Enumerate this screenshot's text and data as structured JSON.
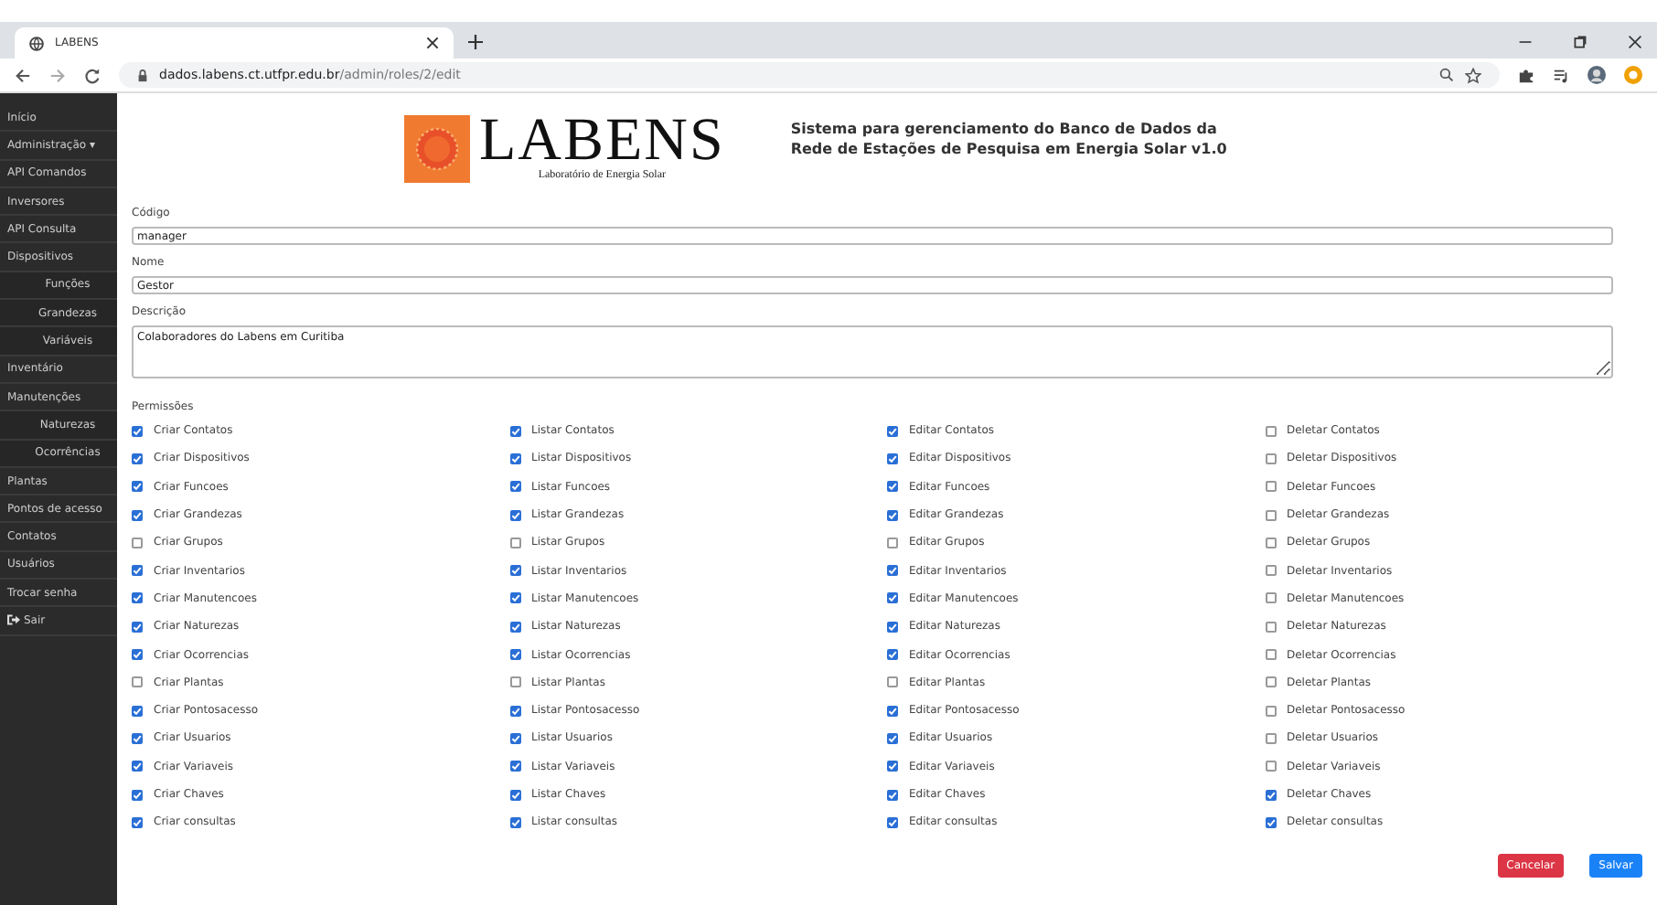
{
  "browser": {
    "tab": {
      "title": "LABENS"
    },
    "url": {
      "host": "dados.labens.ct.utfpr.edu.br",
      "path": "/admin/roles/2/edit"
    }
  },
  "sidebar": {
    "items": [
      {
        "label": "Início",
        "kind": "link"
      },
      {
        "label": "Administração ▾",
        "kind": "link"
      },
      {
        "label": "API Comandos",
        "kind": "link"
      },
      {
        "label": "Inversores",
        "kind": "link"
      },
      {
        "label": "API Consulta",
        "kind": "link"
      },
      {
        "label": "Dispositivos",
        "kind": "link",
        "children": [
          {
            "label": "Funções"
          },
          {
            "label": "Grandezas"
          },
          {
            "label": "Variáveis"
          }
        ]
      },
      {
        "label": "Inventário",
        "kind": "link"
      },
      {
        "label": "Manutenções",
        "kind": "link",
        "children": [
          {
            "label": "Naturezas"
          },
          {
            "label": "Ocorrências"
          }
        ]
      },
      {
        "label": "Plantas",
        "kind": "link"
      },
      {
        "label": "Pontos de acesso",
        "kind": "link"
      },
      {
        "label": "Contatos",
        "kind": "link"
      },
      {
        "label": "Usuários",
        "kind": "link"
      },
      {
        "label": "Trocar senha",
        "kind": "link"
      },
      {
        "label": "Sair",
        "kind": "logout"
      }
    ]
  },
  "header": {
    "logo": {
      "title": "LABENS",
      "subtitle": "Laboratório de Energia Solar"
    },
    "system_title": [
      "Sistema para gerenciamento do Banco de Dados da",
      "Rede de Estações de Pesquisa em Energia Solar v1.0"
    ]
  },
  "form": {
    "fields": [
      {
        "label": "Código",
        "value": "manager",
        "kind": "input"
      },
      {
        "label": "Nome",
        "value": "Gestor",
        "kind": "input"
      },
      {
        "label": "Descrição",
        "value": "Colaboradores do Labens em Curitiba",
        "kind": "textarea"
      }
    ],
    "permissions": {
      "label": "Permissões",
      "items": [
        {
          "label": "Criar Contatos",
          "checked": true
        },
        {
          "label": "Listar Contatos",
          "checked": true
        },
        {
          "label": "Editar Contatos",
          "checked": true
        },
        {
          "label": "Deletar Contatos",
          "checked": false
        },
        {
          "label": "Criar Dispositivos",
          "checked": true
        },
        {
          "label": "Listar Dispositivos",
          "checked": true
        },
        {
          "label": "Editar Dispositivos",
          "checked": true
        },
        {
          "label": "Deletar Dispositivos",
          "checked": false
        },
        {
          "label": "Criar Funcoes",
          "checked": true
        },
        {
          "label": "Listar Funcoes",
          "checked": true
        },
        {
          "label": "Editar Funcoes",
          "checked": true
        },
        {
          "label": "Deletar Funcoes",
          "checked": false
        },
        {
          "label": "Criar Grandezas",
          "checked": true
        },
        {
          "label": "Listar Grandezas",
          "checked": true
        },
        {
          "label": "Editar Grandezas",
          "checked": true
        },
        {
          "label": "Deletar Grandezas",
          "checked": false
        },
        {
          "label": "Criar Grupos",
          "checked": false
        },
        {
          "label": "Listar Grupos",
          "checked": false
        },
        {
          "label": "Editar Grupos",
          "checked": false
        },
        {
          "label": "Deletar Grupos",
          "checked": false
        },
        {
          "label": "Criar Inventarios",
          "checked": true
        },
        {
          "label": "Listar Inventarios",
          "checked": true
        },
        {
          "label": "Editar Inventarios",
          "checked": true
        },
        {
          "label": "Deletar Inventarios",
          "checked": false
        },
        {
          "label": "Criar Manutencoes",
          "checked": true
        },
        {
          "label": "Listar Manutencoes",
          "checked": true
        },
        {
          "label": "Editar Manutencoes",
          "checked": true
        },
        {
          "label": "Deletar Manutencoes",
          "checked": false
        },
        {
          "label": "Criar Naturezas",
          "checked": true
        },
        {
          "label": "Listar Naturezas",
          "checked": true
        },
        {
          "label": "Editar Naturezas",
          "checked": true
        },
        {
          "label": "Deletar Naturezas",
          "checked": false
        },
        {
          "label": "Criar Ocorrencias",
          "checked": true
        },
        {
          "label": "Listar Ocorrencias",
          "checked": true
        },
        {
          "label": "Editar Ocorrencias",
          "checked": true
        },
        {
          "label": "Deletar Ocorrencias",
          "checked": false
        },
        {
          "label": "Criar Plantas",
          "checked": false
        },
        {
          "label": "Listar Plantas",
          "checked": false
        },
        {
          "label": "Editar Plantas",
          "checked": false
        },
        {
          "label": "Deletar Plantas",
          "checked": false
        },
        {
          "label": "Criar Pontosacesso",
          "checked": true
        },
        {
          "label": "Listar Pontosacesso",
          "checked": true
        },
        {
          "label": "Editar Pontosacesso",
          "checked": true
        },
        {
          "label": "Deletar Pontosacesso",
          "checked": false
        },
        {
          "label": "Criar Usuarios",
          "checked": true
        },
        {
          "label": "Listar Usuarios",
          "checked": true
        },
        {
          "label": "Editar Usuarios",
          "checked": true
        },
        {
          "label": "Deletar Usuarios",
          "checked": false
        },
        {
          "label": "Criar Variaveis",
          "checked": true
        },
        {
          "label": "Listar Variaveis",
          "checked": true
        },
        {
          "label": "Editar Variaveis",
          "checked": true
        },
        {
          "label": "Deletar Variaveis",
          "checked": false
        },
        {
          "label": "Criar Chaves",
          "checked": true
        },
        {
          "label": "Listar Chaves",
          "checked": true
        },
        {
          "label": "Editar Chaves",
          "checked": true
        },
        {
          "label": "Deletar Chaves",
          "checked": true
        },
        {
          "label": "Criar consultas",
          "checked": true
        },
        {
          "label": "Listar consultas",
          "checked": true
        },
        {
          "label": "Editar consultas",
          "checked": true
        },
        {
          "label": "Deletar consultas",
          "checked": true
        }
      ]
    }
  },
  "buttons": [
    {
      "label": "Cancelar",
      "kind": "danger"
    },
    {
      "label": "Salvar",
      "kind": "primary"
    }
  ]
}
